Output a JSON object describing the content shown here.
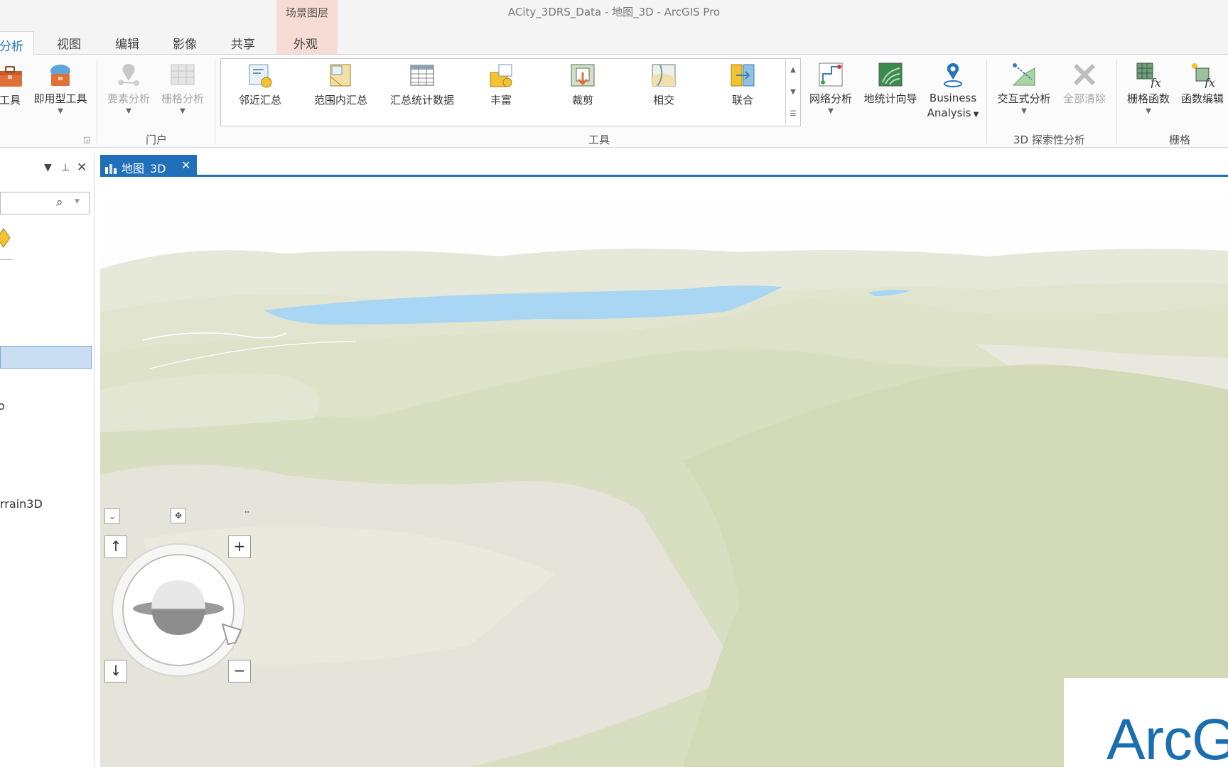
{
  "window": {
    "title": "ACity_3DRS_Data - 地图_3D - ArcGIS Pro"
  },
  "context_tab_group": {
    "label": "场景图层"
  },
  "tabs": [
    {
      "label": "分析",
      "active": true
    },
    {
      "label": "视图"
    },
    {
      "label": "编辑"
    },
    {
      "label": "影像"
    },
    {
      "label": "共享"
    },
    {
      "label": "外观"
    }
  ],
  "ribbon": {
    "geoprocessing": {
      "tools_label": "工具",
      "ready_tools_label": "即用型工具"
    },
    "portal": {
      "feature_analysis": "要素分析",
      "raster_analysis": "栅格分析",
      "group_label": "门户"
    },
    "tools_gallery": {
      "items": [
        "邻近汇总",
        "范围内汇总",
        "汇总统计数据",
        "丰富",
        "裁剪",
        "相交",
        "联合"
      ],
      "group_label": "工具"
    },
    "workflows": {
      "network_analysis": "网络分析",
      "geostat_wizard": "地统计向导",
      "business_line1": "Business",
      "business_line2": "Analysis"
    },
    "exploratory_3d": {
      "interactive_analysis": "交互式分析",
      "clear_all": "全部清除",
      "group_label": "3D 探索性分析"
    },
    "raster": {
      "raster_functions": "栅格函数",
      "function_editor": "函数编辑",
      "group_label": "栅格"
    }
  },
  "contents_pane": {
    "item_partial_1": "o",
    "item_partial_2": "rrain3D"
  },
  "doc_tab": {
    "label": "地图_3D"
  },
  "logo": {
    "text": "ArcG"
  },
  "colors": {
    "accent": "#1f6fb9",
    "water": "#a9d6f3",
    "terrain": "#dfe3cd"
  }
}
